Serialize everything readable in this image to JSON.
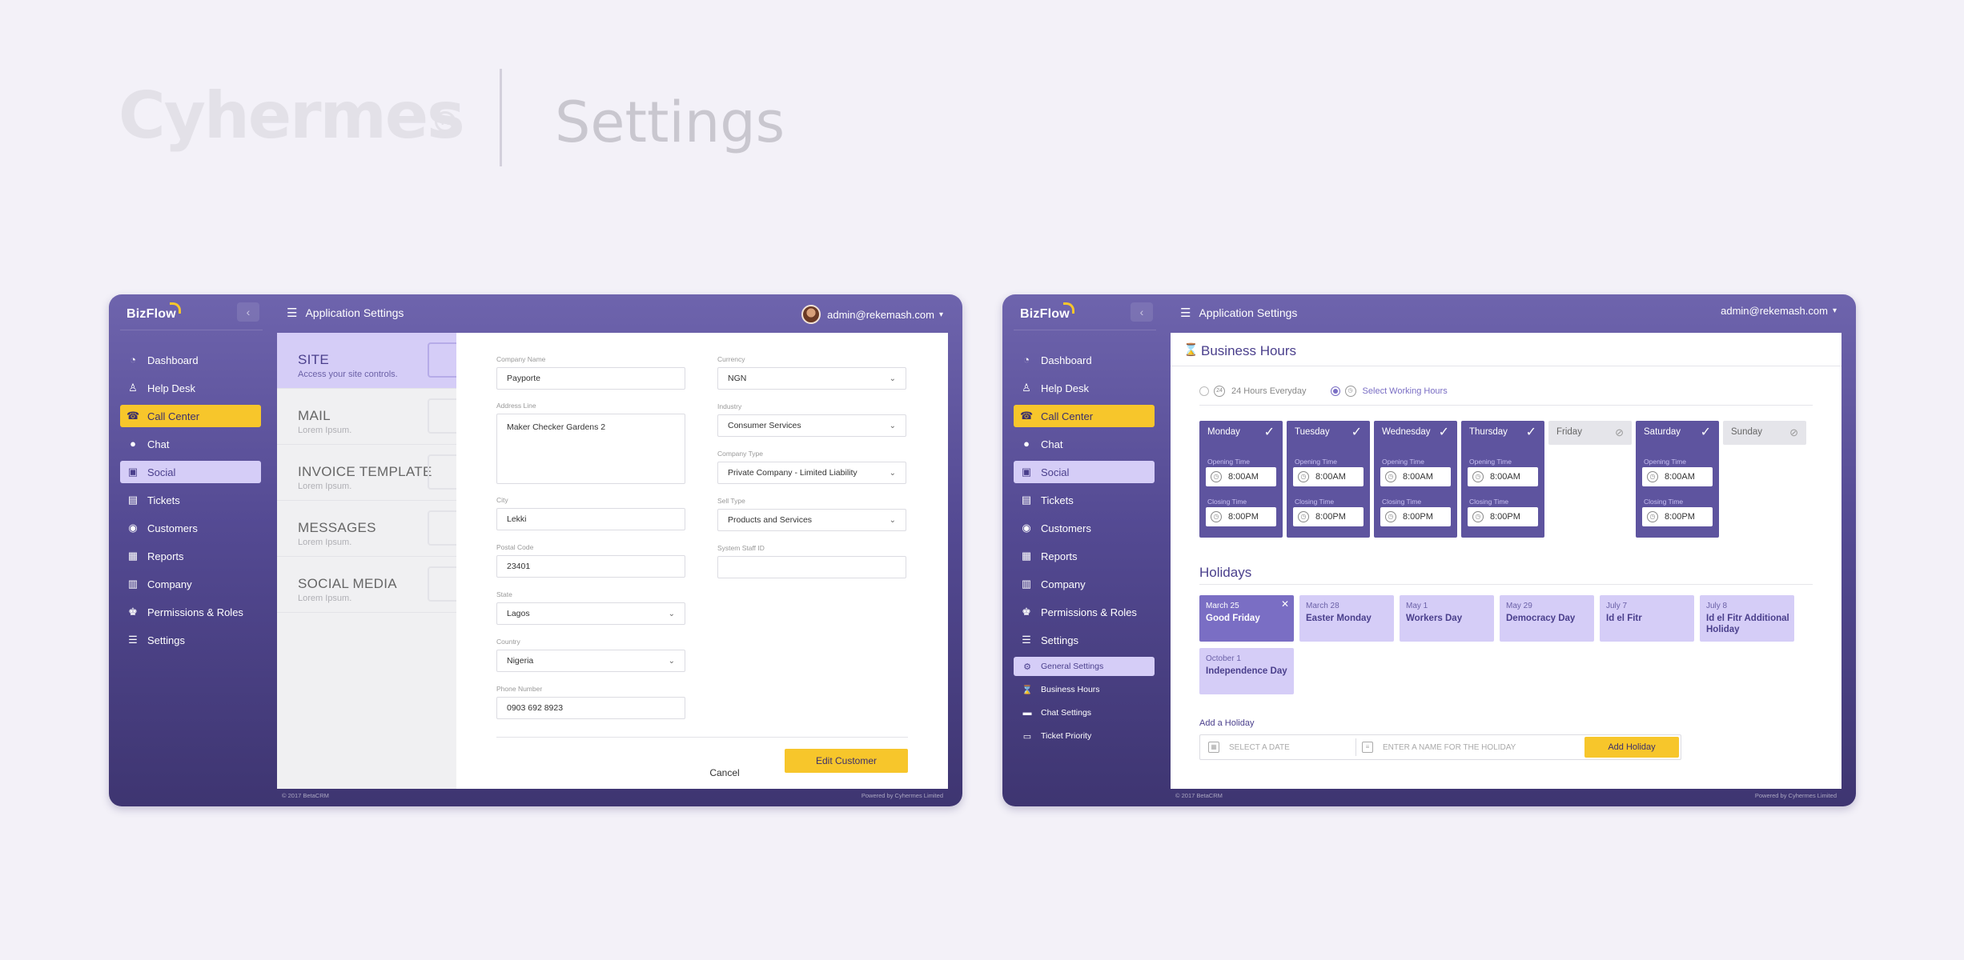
{
  "hero": {
    "brand": "Cyhermes",
    "registered": "R",
    "page": "Settings"
  },
  "app": {
    "logo": "BizFlow",
    "collapse_icon": "chevron-left-icon",
    "title": "Application Settings",
    "user_email": "admin@rekemash.com",
    "footer_left": "© 2017 BetaCRM",
    "footer_right": "Powered by Cyhermes Limited"
  },
  "colors": {
    "accent": "#f7c62b",
    "brand": "#5e549f",
    "lilac": "#d5cdf7",
    "text_purple": "#4a3f8c"
  },
  "sidebar": {
    "items": [
      {
        "label": "Dashboard",
        "icon": "speedometer-icon"
      },
      {
        "label": "Help Desk",
        "icon": "person-desk-icon"
      },
      {
        "label": "Call Center",
        "icon": "headset-icon"
      },
      {
        "label": "Chat",
        "icon": "chat-bubble-icon"
      },
      {
        "label": "Social",
        "icon": "social-screen-icon"
      },
      {
        "label": "Tickets",
        "icon": "ticket-icon"
      },
      {
        "label": "Customers",
        "icon": "customer-icon"
      },
      {
        "label": "Reports",
        "icon": "report-icon"
      },
      {
        "label": "Company",
        "icon": "building-icon"
      },
      {
        "label": "Permissions & Roles",
        "icon": "roles-icon"
      },
      {
        "label": "Settings",
        "icon": "sliders-icon"
      }
    ],
    "sub_items": [
      {
        "label": "General Settings",
        "icon": "gear-icon"
      },
      {
        "label": "Business Hours",
        "icon": "hourglass-icon"
      },
      {
        "label": "Chat Settings",
        "icon": "chat-icon"
      },
      {
        "label": "Ticket Priority",
        "icon": "ticket-icon"
      }
    ]
  },
  "settings_menu": [
    {
      "title": "SITE",
      "subtitle": "Access your site controls."
    },
    {
      "title": "MAIL",
      "subtitle": "Lorem Ipsum."
    },
    {
      "title": "INVOICE TEMPLATE",
      "subtitle": "Lorem Ipsum."
    },
    {
      "title": "MESSAGES",
      "subtitle": "Lorem Ipsum."
    },
    {
      "title": "SOCIAL MEDIA",
      "subtitle": "Lorem Ipsum."
    }
  ],
  "form": {
    "company_name": {
      "label": "Company Name",
      "value": "Payporte"
    },
    "address": {
      "label": "Address Line",
      "value": "Maker Checker Gardens 2"
    },
    "city": {
      "label": "City",
      "value": "Lekki"
    },
    "postal": {
      "label": "Postal Code",
      "value": "23401"
    },
    "state": {
      "label": "State",
      "value": "Lagos"
    },
    "country": {
      "label": "Country",
      "value": "Nigeria"
    },
    "phone": {
      "label": "Phone Number",
      "value": "0903 692 8923"
    },
    "currency": {
      "label": "Currency",
      "value": "NGN"
    },
    "industry": {
      "label": "Industry",
      "value": "Consumer Services"
    },
    "company_type": {
      "label": "Company Type",
      "value": "Private Company - Limited Liability"
    },
    "sell_type": {
      "label": "Sell Type",
      "value": "Products and Services"
    },
    "staff_id": {
      "label": "System Staff ID",
      "value": ""
    },
    "cancel": "Cancel",
    "submit": "Edit Customer"
  },
  "business_hours": {
    "title": "Business Hours",
    "option_all": "24 Hours Everyday",
    "option_select": "Select Working Hours",
    "opening_label": "Opening Time",
    "closing_label": "Closing Time",
    "days": [
      {
        "name": "Monday",
        "open": true,
        "opening": "8:00AM",
        "closing": "8:00PM"
      },
      {
        "name": "Tuesday",
        "open": true,
        "opening": "8:00AM",
        "closing": "8:00PM"
      },
      {
        "name": "Wednesday",
        "open": true,
        "opening": "8:00AM",
        "closing": "8:00PM"
      },
      {
        "name": "Thursday",
        "open": true,
        "opening": "8:00AM",
        "closing": "8:00PM"
      },
      {
        "name": "Friday",
        "open": false
      },
      {
        "name": "Saturday",
        "open": true,
        "opening": "8:00AM",
        "closing": "8:00PM"
      },
      {
        "name": "Sunday",
        "open": false
      }
    ]
  },
  "holidays": {
    "title": "Holidays",
    "items": [
      {
        "date": "March 25",
        "name": "Good Friday"
      },
      {
        "date": "March 28",
        "name": "Easter Monday"
      },
      {
        "date": "May 1",
        "name": "Workers Day"
      },
      {
        "date": "May 29",
        "name": "Democracy Day"
      },
      {
        "date": "July 7",
        "name": "Id el Fitr"
      },
      {
        "date": "July 8",
        "name": "Id el Fitr Additional Holiday"
      },
      {
        "date": "October 1",
        "name": "Independence Day"
      }
    ],
    "add_label": "Add a Holiday",
    "date_placeholder": "SELECT A DATE",
    "name_placeholder": "ENTER A NAME FOR THE HOLIDAY",
    "add_button": "Add Holiday"
  }
}
